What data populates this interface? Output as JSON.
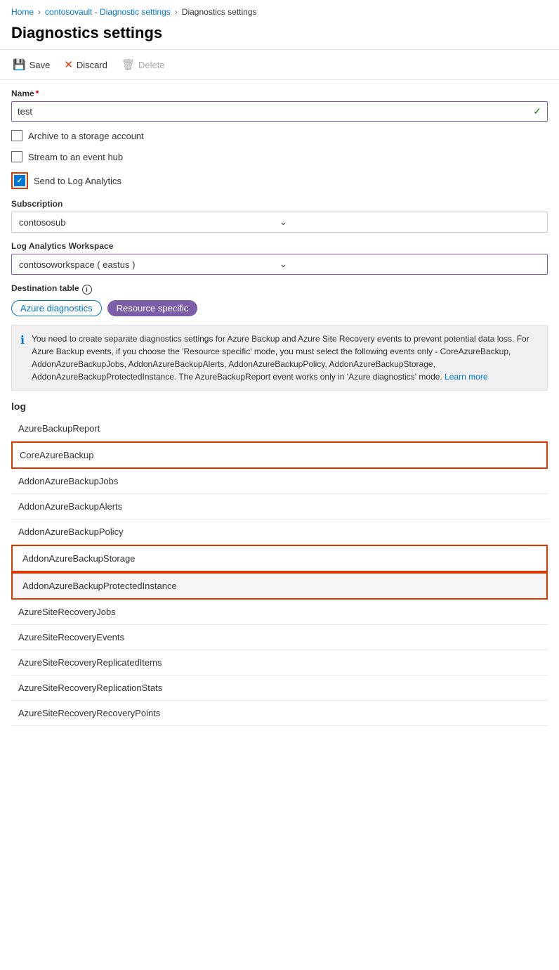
{
  "breadcrumb": {
    "home": "Home",
    "vault": "contosovault - Diagnostic settings",
    "current": "Diagnostics settings"
  },
  "page": {
    "title": "Diagnostics settings"
  },
  "toolbar": {
    "save": "Save",
    "discard": "Discard",
    "delete": "Delete"
  },
  "form": {
    "name_label": "Name",
    "name_required": "*",
    "name_value": "test",
    "archive_label": "Archive to a storage account",
    "stream_label": "Stream to an event hub",
    "send_label": "Send to Log Analytics",
    "subscription_label": "Subscription",
    "subscription_value": "contososub",
    "workspace_label": "Log Analytics Workspace",
    "workspace_value": "contosoworkspace ( eastus )",
    "destination_label": "Destination table",
    "dest_option1": "Azure diagnostics",
    "dest_option2": "Resource specific",
    "info_text": "You need to create separate diagnostics settings for Azure Backup and Azure Site Recovery events to prevent potential data loss. For Azure Backup events, if you choose the 'Resource specific' mode, you must select the following events only - CoreAzureBackup, AddonAzureBackupJobs, AddonAzureBackupAlerts, AddonAzureBackupPolicy, AddonAzureBackupStorage, AddonAzureBackupProtectedInstance. The AzureBackupReport event works only in 'Azure diagnostics' mode.",
    "learn_more": "Learn more",
    "log_label": "log"
  },
  "log_items": [
    {
      "name": "AzureBackupReport",
      "checked": false,
      "highlight": false,
      "red_border": false
    },
    {
      "name": "CoreAzureBackup",
      "checked": true,
      "highlight": false,
      "red_border": true
    },
    {
      "name": "AddonAzureBackupJobs",
      "checked": true,
      "highlight": false,
      "red_border": false
    },
    {
      "name": "AddonAzureBackupAlerts",
      "checked": true,
      "highlight": false,
      "red_border": false
    },
    {
      "name": "AddonAzureBackupPolicy",
      "checked": true,
      "highlight": false,
      "red_border": false
    },
    {
      "name": "AddonAzureBackupStorage",
      "checked": true,
      "highlight": false,
      "red_border": true
    },
    {
      "name": "AddonAzureBackupProtectedInstance",
      "checked": true,
      "highlight": true,
      "red_border": true
    },
    {
      "name": "AzureSiteRecoveryJobs",
      "checked": false,
      "highlight": false,
      "red_border": false
    },
    {
      "name": "AzureSiteRecoveryEvents",
      "checked": false,
      "highlight": false,
      "red_border": false
    },
    {
      "name": "AzureSiteRecoveryReplicatedItems",
      "checked": false,
      "highlight": false,
      "red_border": false
    },
    {
      "name": "AzureSiteRecoveryReplicationStats",
      "checked": false,
      "highlight": false,
      "red_border": false
    },
    {
      "name": "AzureSiteRecoveryRecoveryPoints",
      "checked": false,
      "highlight": false,
      "red_border": false
    }
  ]
}
